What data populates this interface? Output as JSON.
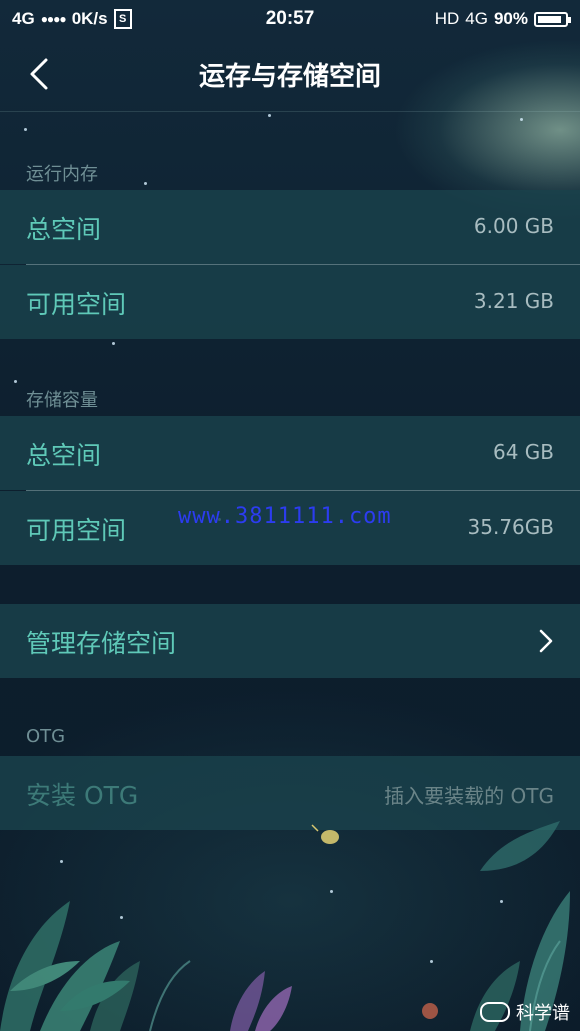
{
  "status_bar": {
    "network": "4G",
    "signal_dots": "●●●●",
    "speed": "0K/s",
    "sim_icon": "S",
    "time": "20:57",
    "hd": "HD",
    "network_right": "4G",
    "battery_percent": "90%",
    "battery_level": 0.9
  },
  "header": {
    "title": "运存与存储空间",
    "back_icon": "chevron-left-icon"
  },
  "ram": {
    "section_label": "运行内存",
    "total_label": "总空间",
    "total_value": "6.00 GB",
    "available_label": "可用空间",
    "available_value": "3.21 GB"
  },
  "storage": {
    "section_label": "存储容量",
    "total_label": "总空间",
    "total_value": "64 GB",
    "available_label": "可用空间",
    "available_value": "35.76GB"
  },
  "manage": {
    "label": "管理存储空间",
    "chevron_icon": "chevron-right-icon"
  },
  "otg": {
    "section_label": "OTG",
    "install_label": "安装 OTG",
    "install_hint": "插入要装载的 OTG"
  },
  "watermark": "www.3811111.com",
  "brand": "科学谱",
  "colors": {
    "accent": "#5fc9b8",
    "row_bg": "#1a424c",
    "background": "#0f2233"
  }
}
